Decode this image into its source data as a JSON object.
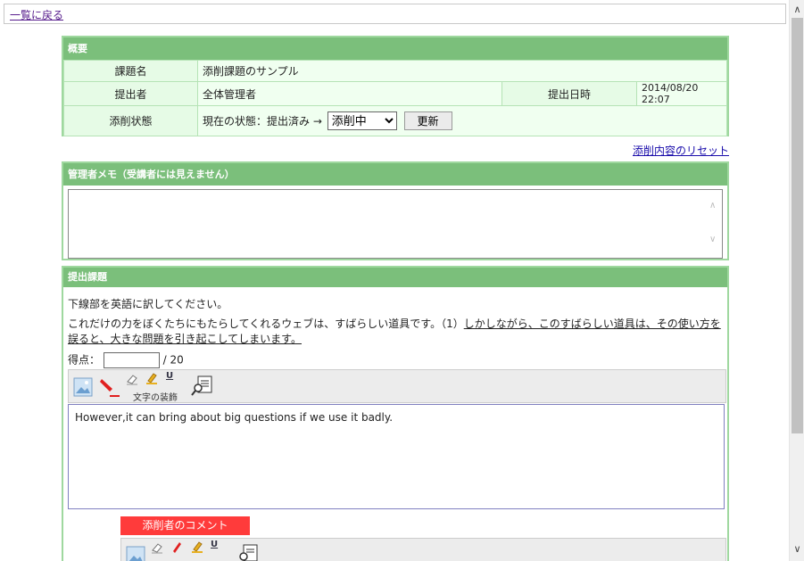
{
  "nav": {
    "back_link": "一覧に戻る"
  },
  "overview": {
    "header": "概要",
    "task_name_label": "課題名",
    "task_name_value": "添削課題のサンプル",
    "submitter_label": "提出者",
    "submitter_value": "全体管理者",
    "submitted_at_label": "提出日時",
    "submitted_at_value": "2014/08/20 22:07",
    "status_label": "添削状態",
    "status_text": "現在の状態：提出済み →",
    "status_select_value": "添削中",
    "update_button": "更新"
  },
  "reset_link": "添削内容のリセット",
  "admin_memo": {
    "header": "管理者メモ（受講者には見えません）",
    "value": ""
  },
  "submission": {
    "header": "提出課題",
    "instruction": "下線部を英語に訳してください。",
    "passage_plain": "これだけの力をぼくたちにもたらしてくれるウェブは、すばらしい道具です。（1）",
    "passage_underlined": "しかしながら、このすばらしい道具は、その使い方を誤ると、大きな問題を引き起こしてしまいます。",
    "score_label": "得点：",
    "score_value": "",
    "score_max": "/ 20",
    "toolbar_decoration_label": "文字の装飾",
    "answer_text": "However,it can bring about big questions if we use it badly.",
    "comment_button": "添削者のコメント"
  },
  "icons": {
    "scroll_up": "scroll-up-icon",
    "scroll_down": "scroll-down-icon",
    "image": "image-icon",
    "pen": "red-pen-icon",
    "eraser": "eraser-icon",
    "highlighter": "highlighter-icon",
    "underline": "underline-icon",
    "preview": "preview-icon"
  },
  "colors": {
    "header_green": "#7bbf7b",
    "border_green": "#9fd89f",
    "label_bg": "#e6fbe6",
    "comment_red": "#ff3b3b"
  }
}
